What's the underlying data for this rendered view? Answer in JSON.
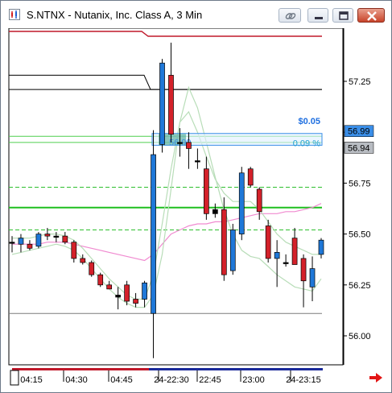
{
  "window": {
    "title": "S.NTNX - Nutanix, Inc. Class A, 3 Min",
    "icons": [
      "chart-app-icon",
      "link-icon",
      "minimize-icon",
      "restore-icon",
      "close-icon"
    ]
  },
  "chart_data": {
    "type": "candlestick",
    "symbol": "S.NTNX",
    "interval": "3 Min",
    "ylim": [
      55.88,
      57.45
    ],
    "y_ticks": [
      "57.25",
      "57.00",
      "56.75",
      "56.50",
      "56.25",
      "56.00"
    ],
    "x_ticks": [
      "04:15",
      "04:30",
      "04:45",
      "24-22:30",
      "22:45",
      "23:00",
      "24-23:15"
    ],
    "price_labels": [
      {
        "label": "56.99",
        "value": 56.99,
        "style": "highlight"
      },
      {
        "label": "56.94",
        "value": 56.94,
        "style": "dark"
      }
    ],
    "annotation": {
      "dollar": "$0.05",
      "percent": "0.09 %",
      "line_label": "56.99"
    },
    "horizontal_lines": [
      {
        "value": 57.21,
        "color": "#000000"
      },
      {
        "value": 56.98,
        "color": "#4fcf4f"
      },
      {
        "value": 56.95,
        "color": "#4fcf4f"
      },
      {
        "value": 56.73,
        "color": "#2fbf2f",
        "dashed": true
      },
      {
        "value": 56.63,
        "color": "#1fbf1f"
      },
      {
        "value": 56.52,
        "color": "#2fbf2f",
        "dashed": true
      },
      {
        "value": 56.11,
        "color": "#7a7a7a"
      }
    ],
    "candles": [
      {
        "o": 56.46,
        "h": 56.49,
        "l": 56.41,
        "c": 56.46,
        "dir": "flat"
      },
      {
        "o": 56.45,
        "h": 56.5,
        "l": 56.41,
        "c": 56.48,
        "dir": "up"
      },
      {
        "o": 56.45,
        "h": 56.47,
        "l": 56.42,
        "c": 56.43,
        "dir": "down"
      },
      {
        "o": 56.44,
        "h": 56.51,
        "l": 56.43,
        "c": 56.5,
        "dir": "up"
      },
      {
        "o": 56.5,
        "h": 56.53,
        "l": 56.47,
        "c": 56.49,
        "dir": "down"
      },
      {
        "o": 56.49,
        "h": 56.51,
        "l": 56.46,
        "c": 56.49,
        "dir": "flat"
      },
      {
        "o": 56.49,
        "h": 56.51,
        "l": 56.45,
        "c": 56.46,
        "dir": "down"
      },
      {
        "o": 56.46,
        "h": 56.47,
        "l": 56.36,
        "c": 56.38,
        "dir": "down"
      },
      {
        "o": 56.38,
        "h": 56.4,
        "l": 56.35,
        "c": 56.36,
        "dir": "down"
      },
      {
        "o": 56.36,
        "h": 56.37,
        "l": 56.29,
        "c": 56.3,
        "dir": "down"
      },
      {
        "o": 56.3,
        "h": 56.31,
        "l": 56.24,
        "c": 56.25,
        "dir": "down"
      },
      {
        "o": 56.25,
        "h": 56.27,
        "l": 56.23,
        "c": 56.23,
        "dir": "down"
      },
      {
        "o": 56.2,
        "h": 56.24,
        "l": 56.13,
        "c": 56.19,
        "dir": "flat"
      },
      {
        "o": 56.25,
        "h": 56.27,
        "l": 56.15,
        "c": 56.17,
        "dir": "down"
      },
      {
        "o": 56.18,
        "h": 56.21,
        "l": 56.14,
        "c": 56.16,
        "dir": "down"
      },
      {
        "o": 56.18,
        "h": 56.27,
        "l": 56.14,
        "c": 56.26,
        "dir": "up"
      },
      {
        "o": 56.11,
        "h": 57.01,
        "l": 55.89,
        "c": 56.89,
        "dir": "up"
      },
      {
        "o": 56.94,
        "h": 57.36,
        "l": 56.9,
        "c": 57.34,
        "dir": "up"
      },
      {
        "o": 57.28,
        "h": 57.44,
        "l": 56.95,
        "c": 56.99,
        "dir": "down"
      },
      {
        "o": 56.95,
        "h": 57.02,
        "l": 56.88,
        "c": 56.95,
        "dir": "flat"
      },
      {
        "o": 56.95,
        "h": 57.0,
        "l": 56.82,
        "c": 56.92,
        "dir": "down"
      },
      {
        "o": 56.86,
        "h": 56.92,
        "l": 56.82,
        "c": 56.86,
        "dir": "flat"
      },
      {
        "o": 56.82,
        "h": 56.88,
        "l": 56.57,
        "c": 56.6,
        "dir": "down"
      },
      {
        "o": 56.6,
        "h": 56.65,
        "l": 56.58,
        "c": 56.62,
        "dir": "flat"
      },
      {
        "o": 56.62,
        "h": 56.68,
        "l": 56.27,
        "c": 56.3,
        "dir": "down"
      },
      {
        "o": 56.32,
        "h": 56.55,
        "l": 56.3,
        "c": 56.52,
        "dir": "up"
      },
      {
        "o": 56.5,
        "h": 56.83,
        "l": 56.47,
        "c": 56.8,
        "dir": "up"
      },
      {
        "o": 56.82,
        "h": 56.83,
        "l": 56.73,
        "c": 56.74,
        "dir": "down"
      },
      {
        "o": 56.72,
        "h": 56.73,
        "l": 56.57,
        "c": 56.61,
        "dir": "down"
      },
      {
        "o": 56.54,
        "h": 56.57,
        "l": 56.36,
        "c": 56.38,
        "dir": "down"
      },
      {
        "o": 56.41,
        "h": 56.47,
        "l": 56.24,
        "c": 56.38,
        "dir": "up"
      },
      {
        "o": 56.36,
        "h": 56.4,
        "l": 56.34,
        "c": 56.36,
        "dir": "flat"
      },
      {
        "o": 56.48,
        "h": 56.53,
        "l": 56.35,
        "c": 56.35,
        "dir": "down"
      },
      {
        "o": 56.38,
        "h": 56.4,
        "l": 56.14,
        "c": 56.27,
        "dir": "down"
      },
      {
        "o": 56.24,
        "h": 56.39,
        "l": 56.17,
        "c": 56.33,
        "dir": "up"
      },
      {
        "o": 56.4,
        "h": 56.48,
        "l": 56.38,
        "c": 56.47,
        "dir": "up"
      }
    ],
    "series": [
      {
        "name": "",
        "color": "#f08ad0",
        "values": [
          56.45,
          56.45,
          56.45,
          56.45,
          56.46,
          56.46,
          56.46,
          56.45,
          56.44,
          56.43,
          56.42,
          56.41,
          56.4,
          56.39,
          56.38,
          56.37,
          56.4,
          56.45,
          56.5,
          56.52,
          56.54,
          56.55,
          56.55,
          56.56,
          56.56,
          56.57,
          56.58,
          56.59,
          56.6,
          56.6,
          56.6,
          56.61,
          56.61,
          56.62,
          56.63,
          56.65
        ]
      },
      {
        "name": "",
        "color": "#b8ddb8",
        "values": [
          56.48,
          56.48,
          56.48,
          56.49,
          56.5,
          56.5,
          56.49,
          56.47,
          56.43,
          56.38,
          56.33,
          56.28,
          56.24,
          56.2,
          56.18,
          56.18,
          56.3,
          56.55,
          56.82,
          57.05,
          57.1,
          57.0,
          56.88,
          56.77,
          56.7,
          56.66,
          56.66,
          56.66,
          56.62,
          56.56,
          56.5,
          56.46,
          56.44,
          56.42,
          56.4,
          56.4
        ]
      },
      {
        "name": "",
        "color": "#b8ddb8",
        "values": [
          56.4,
          56.41,
          56.42,
          56.43,
          56.44,
          56.45,
          56.44,
          56.42,
          56.38,
          56.33,
          56.28,
          56.23,
          56.19,
          56.16,
          56.14,
          56.14,
          56.2,
          56.4,
          56.72,
          57.05,
          57.22,
          57.12,
          56.95,
          56.78,
          56.62,
          56.5,
          56.42,
          56.39,
          56.38,
          56.34,
          56.3,
          56.27,
          56.24,
          56.23,
          56.22,
          56.28
        ]
      }
    ]
  }
}
